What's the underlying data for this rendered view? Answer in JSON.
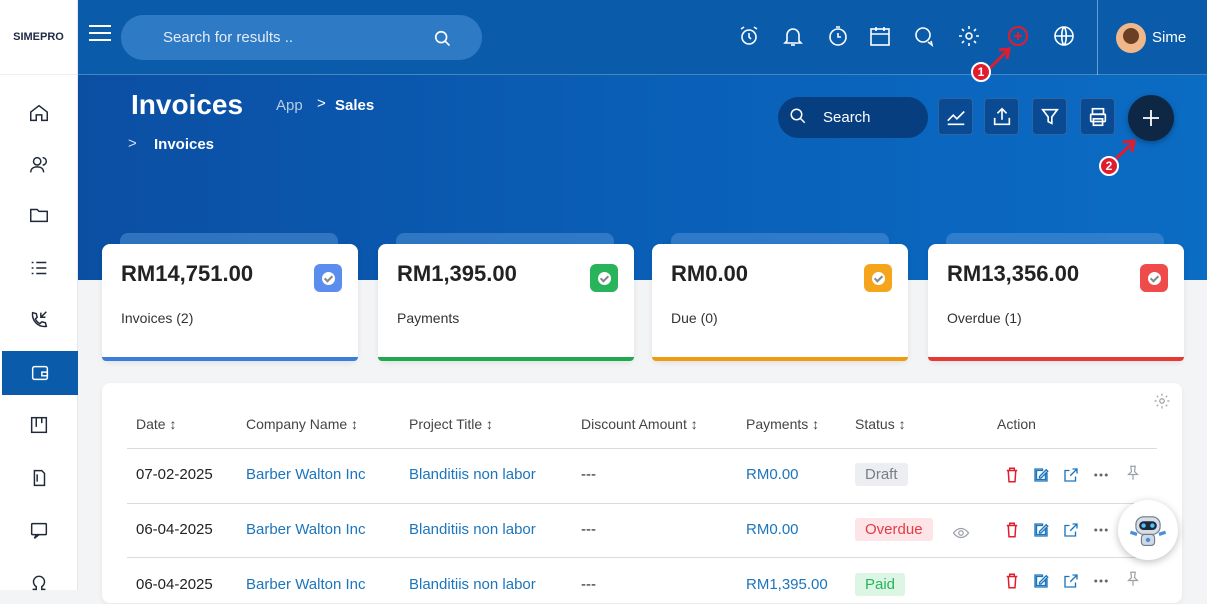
{
  "brand": {
    "logo_main": "SIME",
    "logo_accent": "PRO"
  },
  "header": {
    "search_placeholder": "Search for results ..",
    "user_name": "Sime",
    "badge_1": "1",
    "badge_2": "2"
  },
  "page": {
    "title": "Invoices",
    "breadcrumb": {
      "app": "App",
      "sep": ">",
      "sales": "Sales",
      "current": "Invoices"
    },
    "search_label": "Search"
  },
  "cards": [
    {
      "amount": "RM14,751.00",
      "label": "Invoices (2)",
      "color": "#5b8def"
    },
    {
      "amount": "RM1,395.00",
      "label": "Payments",
      "color": "#27b45b"
    },
    {
      "amount": "RM0.00",
      "label": "Due (0)",
      "color": "#f4a51c"
    },
    {
      "amount": "RM13,356.00",
      "label": "Overdue (1)",
      "color": "#ef4b4b"
    }
  ],
  "table": {
    "headers": [
      "Date ↕",
      "Company Name ↕",
      "Project Title ↕",
      "Discount Amount ↕",
      "Payments ↕",
      "Status ↕",
      "Action"
    ],
    "rows": [
      {
        "date": "07-02-2025",
        "company": "Barber Walton Inc",
        "project": "Blanditiis non labor",
        "discount": "---",
        "payments": "RM0.00",
        "status": "Draft"
      },
      {
        "date": "06-04-2025",
        "company": "Barber Walton Inc",
        "project": "Blanditiis non labor",
        "discount": "---",
        "payments": "RM0.00",
        "status": "Overdue"
      },
      {
        "date": "06-04-2025",
        "company": "Barber Walton Inc",
        "project": "Blanditiis non labor",
        "discount": "---",
        "payments": "RM1,395.00",
        "status": "Paid"
      }
    ]
  },
  "colors": {
    "header_blue": "#0a5cab",
    "link": "#1c75bc",
    "danger": "#e11d2d"
  }
}
